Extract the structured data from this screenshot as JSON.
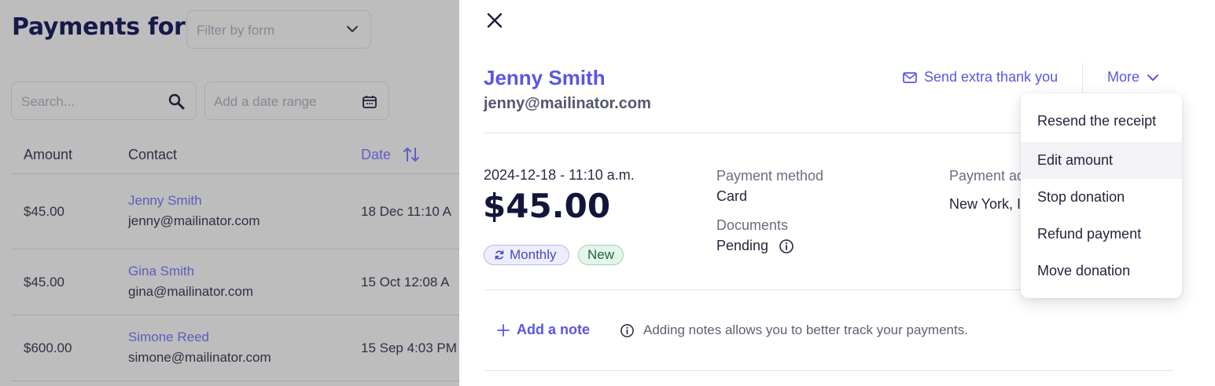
{
  "background": {
    "title": "Payments for",
    "form_filter": {
      "placeholder": "Filter by form"
    },
    "search": {
      "placeholder": "Search..."
    },
    "date_range": {
      "placeholder": "Add a date range"
    },
    "table": {
      "headers": {
        "amount": "Amount",
        "contact": "Contact",
        "date": "Date"
      },
      "rows": [
        {
          "amount": "$45.00",
          "name": "Jenny Smith",
          "email": "jenny@mailinator.com",
          "date": "18 Dec 11:10 A"
        },
        {
          "amount": "$45.00",
          "name": "Gina Smith",
          "email": "gina@mailinator.com",
          "date": "15 Oct 12:08 A"
        },
        {
          "amount": "$600.00",
          "name": "Simone Reed",
          "email": "simone@mailinator.com",
          "date": "15 Sep 4:03 PM"
        }
      ]
    }
  },
  "panel": {
    "contact": {
      "name": "Jenny Smith",
      "email": "jenny@mailinator.com"
    },
    "actions": {
      "send_thanks": "Send extra thank you",
      "more": "More"
    },
    "payment": {
      "datetime": "2024-12-18 - 11:10 a.m.",
      "amount": "$45.00",
      "badges": {
        "frequency": "Monthly",
        "status": "New"
      },
      "method_label": "Payment method",
      "method_value": "Card",
      "documents_label": "Documents",
      "documents_value": "Pending",
      "address_label": "Payment ad",
      "address_value": "New York, I"
    },
    "notes": {
      "add_label": "Add a note",
      "hint": "Adding notes allows you to better track your payments."
    }
  },
  "more_menu": {
    "items": [
      "Resend the receipt",
      "Edit amount",
      "Stop donation",
      "Refund payment",
      "Move donation"
    ],
    "highlighted": "Edit amount"
  },
  "colors": {
    "accent": "#5b55e3",
    "overlay": "#bdbdbd",
    "navy": "#13163c"
  }
}
